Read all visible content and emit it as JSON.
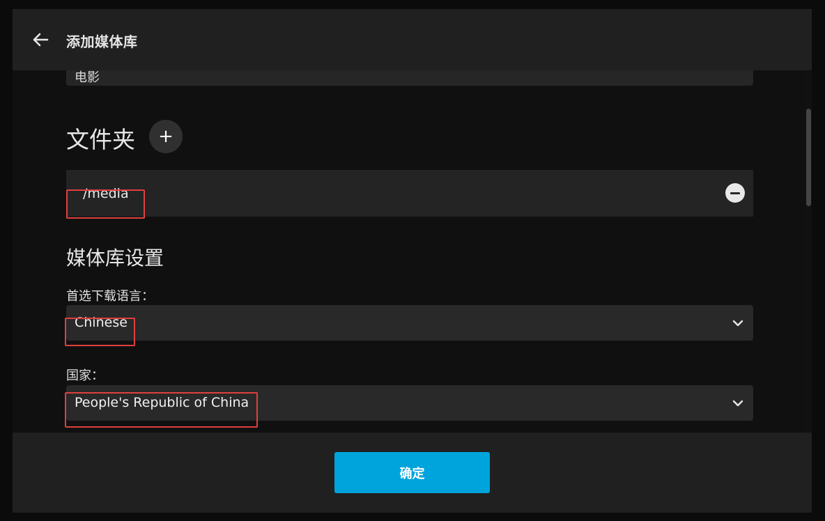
{
  "header": {
    "title": "添加媒体库",
    "back_icon": "arrow-left-icon"
  },
  "library_name": {
    "value": "电影"
  },
  "folders": {
    "title": "文件夹",
    "add_label": "+",
    "items": [
      {
        "path": "/media"
      }
    ]
  },
  "settings": {
    "title": "媒体库设置",
    "language_label": "首选下载语言：",
    "language_value": "Chinese",
    "country_label": "国家：",
    "country_value": "People's Republic of China"
  },
  "footer": {
    "ok_label": "确定"
  },
  "colors": {
    "accent": "#00a4dc",
    "highlight": "#e0403e",
    "background": "#101010",
    "panel": "#202020"
  }
}
